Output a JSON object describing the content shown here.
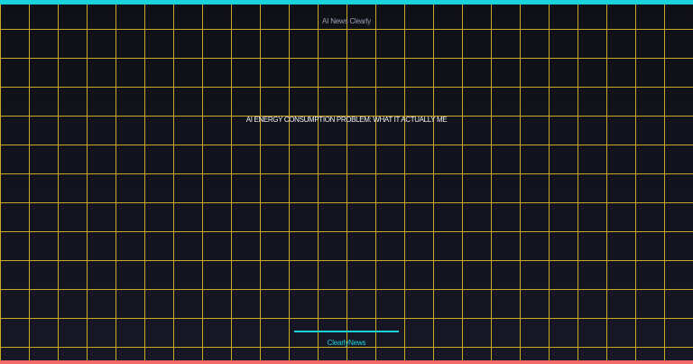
{
  "brand": {
    "top_label": "AI News Clearly",
    "bottom_label": "ClearlyNews"
  },
  "headline": "AI ENERGY CONSUMPTION PROBLEM: WHAT IT ACTUALLY ME",
  "colors": {
    "background": "#111119",
    "grid": "#d6b225",
    "accent": "#1ad3dd",
    "bottom_bar": "#f26a6a"
  }
}
